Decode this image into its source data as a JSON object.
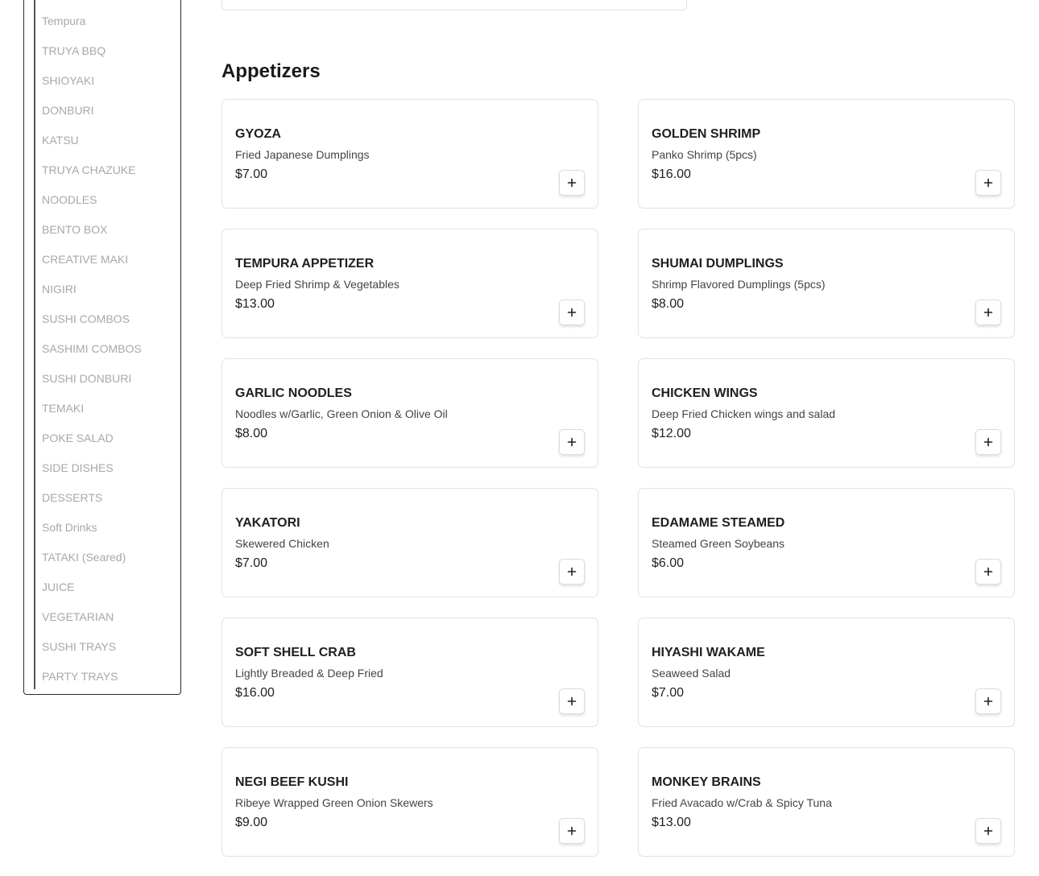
{
  "sidebar": {
    "items": [
      "Tempura",
      "TRUYA BBQ",
      "SHIOYAKI",
      "DONBURI",
      "KATSU",
      "TRUYA CHAZUKE",
      "NOODLES",
      "BENTO BOX",
      "CREATIVE MAKI",
      "NIGIRI",
      "SUSHI COMBOS",
      "SASHIMI COMBOS",
      "SUSHI DONBURI",
      "TEMAKI",
      "POKE SALAD",
      "SIDE DISHES",
      "DESSERTS",
      "Soft Drinks",
      "TATAKI (Seared)",
      "JUICE",
      "VEGETARIAN",
      "SUSHI TRAYS",
      "PARTY TRAYS"
    ]
  },
  "section": {
    "title": "Appetizers"
  },
  "menu_items": [
    {
      "name": "GYOZA",
      "description": "Fried Japanese Dumplings",
      "price": "$7.00"
    },
    {
      "name": "GOLDEN SHRIMP",
      "description": "Panko Shrimp (5pcs)",
      "price": "$16.00"
    },
    {
      "name": "TEMPURA APPETIZER",
      "description": "Deep Fried Shrimp & Vegetables",
      "price": "$13.00"
    },
    {
      "name": "SHUMAI DUMPLINGS",
      "description": "Shrimp Flavored Dumplings (5pcs)",
      "price": "$8.00"
    },
    {
      "name": "GARLIC NOODLES",
      "description": "Noodles w/Garlic, Green Onion & Olive Oil",
      "price": "$8.00"
    },
    {
      "name": "CHICKEN WINGS",
      "description": "Deep Fried Chicken wings and salad",
      "price": "$12.00"
    },
    {
      "name": "YAKATORI",
      "description": "Skewered Chicken",
      "price": "$7.00"
    },
    {
      "name": "EDAMAME STEAMED",
      "description": "Steamed Green Soybeans",
      "price": "$6.00"
    },
    {
      "name": "SOFT SHELL CRAB",
      "description": "Lightly Breaded & Deep Fried",
      "price": "$16.00"
    },
    {
      "name": "HIYASHI WAKAME",
      "description": "Seaweed Salad",
      "price": "$7.00"
    },
    {
      "name": "NEGI BEEF KUSHI",
      "description": "Ribeye Wrapped Green Onion Skewers",
      "price": "$9.00"
    },
    {
      "name": "MONKEY BRAINS",
      "description": "Fried Avacado w/Crab & Spicy Tuna",
      "price": "$13.00"
    }
  ],
  "icons": {
    "add": "plus-icon"
  },
  "colors": {
    "sidebar_text": "#a8a8a8",
    "card_border": "#e2e2e2",
    "text_primary": "#1f1f1f"
  }
}
